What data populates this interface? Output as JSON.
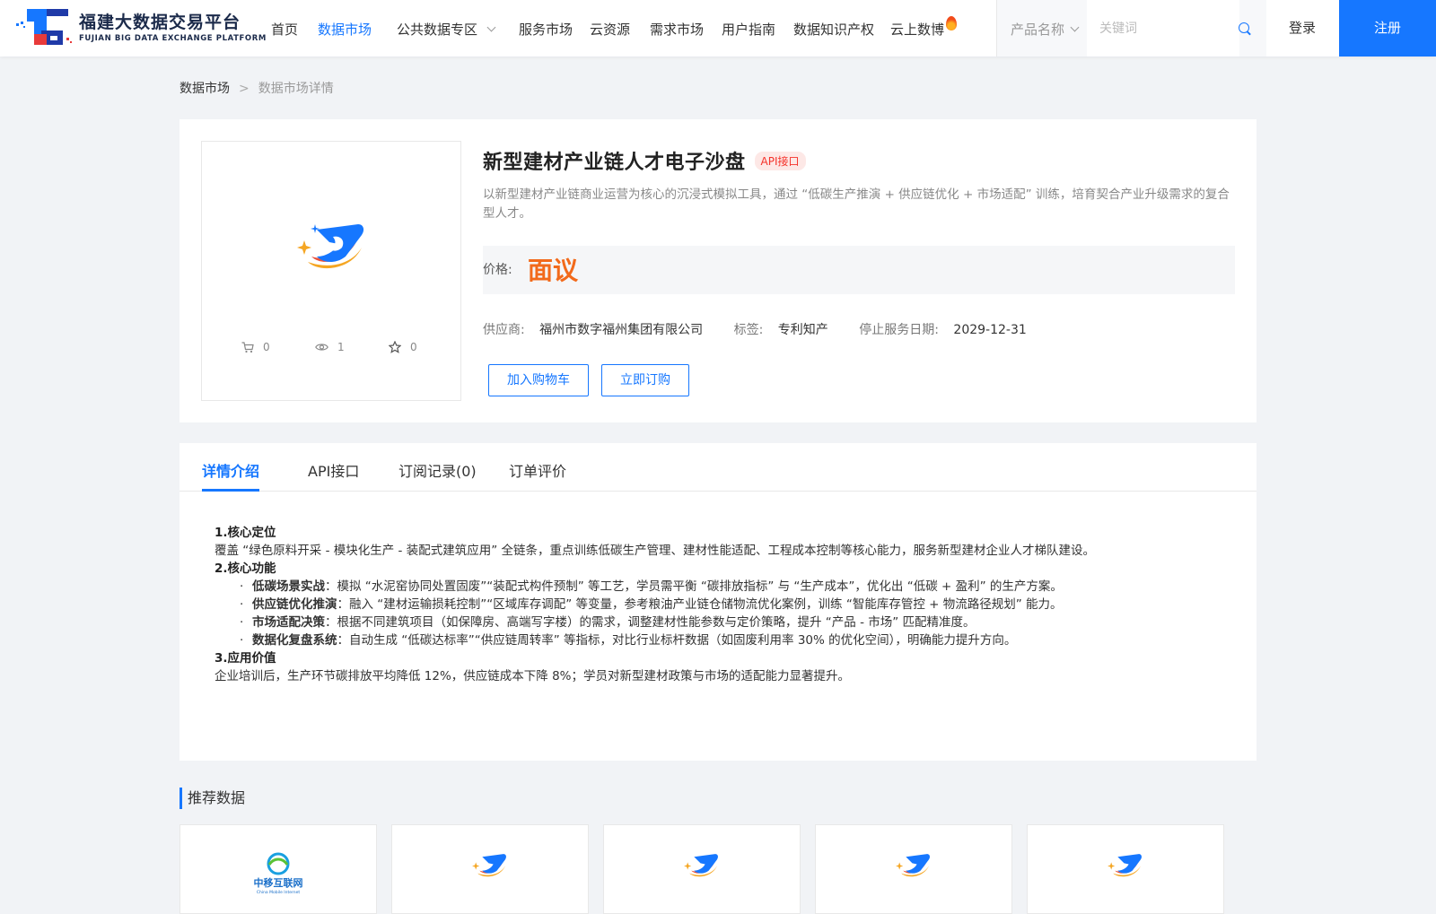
{
  "header": {
    "logo_cn": "福建大数据交易平台",
    "logo_en": "FUJIAN BIG DATA EXCHANGE  PLATFORM",
    "nav": [
      {
        "label": "首页"
      },
      {
        "label": "数据市场"
      },
      {
        "label": "公共数据专区"
      },
      {
        "label": "服务市场"
      },
      {
        "label": "云资源"
      },
      {
        "label": "需求市场"
      },
      {
        "label": "用户指南"
      },
      {
        "label": "数据知识产权"
      },
      {
        "label": "云上数博"
      }
    ],
    "active_nav": "数据市场",
    "search_type": "产品名称",
    "search_placeholder": "关键词",
    "login": "登录",
    "register": "注册",
    "accent_color": "#1677ff"
  },
  "breadcrumb": {
    "parent": "数据市场",
    "separator": ">",
    "current": "数据市场详情"
  },
  "product": {
    "title": "新型建材产业链人才电子沙盘",
    "badge": "API接口",
    "description": "以新型建材产业链商业运营为核心的沉浸式模拟工具，通过 “低碳生产推演 + 供应链优化 + 市场适配” 训练，培育契合产业升级需求的复合型人才。",
    "price_label": "价格:",
    "price_value": "面议",
    "price_color": "#f26a1b",
    "stats": {
      "cart": "0",
      "views": "1",
      "favorites": "0"
    },
    "supplier_label": "供应商:",
    "supplier": "福州市数字福州集团有限公司",
    "tag_label": "标签:",
    "tag": "专利知产",
    "stop_label": "停止服务日期:",
    "stop_date": "2029-12-31",
    "add_cart": "加入购物车",
    "subscribe": "立即订购"
  },
  "tabs": [
    {
      "label": "详情介绍"
    },
    {
      "label": "API接口"
    },
    {
      "label": "订阅记录(0)"
    },
    {
      "label": "订单评价"
    }
  ],
  "detail": {
    "h1": "1.核心定位",
    "p1": "覆盖 “绿色原料开采 - 模块化生产 - 装配式建筑应用” 全链条，重点训练低碳生产管理、建材性能适配、工程成本控制等核心能力，服务新型建材企业人才梯队建设。",
    "h2": "2.核心功能",
    "items": [
      {
        "label": "低碳场景实战",
        "text": "：模拟 “水泥窑协同处置固废”“装配式构件预制” 等工艺，学员需平衡 “碳排放指标” 与 “生产成本”，优化出 “低碳 + 盈利” 的生产方案。"
      },
      {
        "label": "供应链优化推演",
        "text": "：融入 “建材运输损耗控制”“区域库存调配” 等变量，参考粮油产业链仓储物流优化案例，训练 “智能库存管控 + 物流路径规划” 能力。"
      },
      {
        "label": "市场适配决策",
        "text": "：根据不同建筑项目（如保障房、高端写字楼）的需求，调整建材性能参数与定价策略，提升 “产品 - 市场” 匹配精准度。"
      },
      {
        "label": "数据化复盘系统",
        "text": "：自动生成 “低碳达标率”“供应链周转率” 等指标，对比行业标杆数据（如固废利用率 30% 的优化空间），明确能力提升方向。"
      }
    ],
    "h3": "3.应用价值",
    "p3": "企业培训后，生产环节碳排放平均降低 12%，供应链成本下降 8%；学员对新型建材政策与市场的适配能力显著提升。"
  },
  "recommend": {
    "title": "推荐数据",
    "cards": [
      {
        "logo_text": "中移互联网",
        "logo_sub": "China Mobile Internet"
      },
      {},
      {},
      {},
      {}
    ]
  }
}
